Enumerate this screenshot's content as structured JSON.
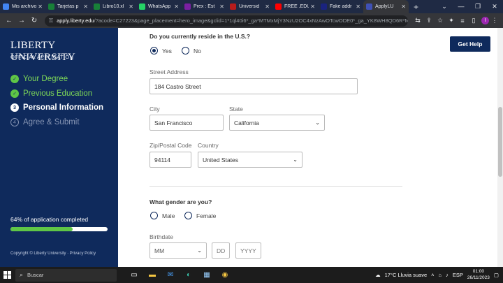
{
  "browser": {
    "tabs": [
      {
        "title": "Mis archivos",
        "color": "#4285f4",
        "active": false
      },
      {
        "title": "Tarjetas p",
        "color": "#188038",
        "active": false
      },
      {
        "title": "Libro10.xl",
        "color": "#188038",
        "active": false
      },
      {
        "title": "WhatsApp",
        "color": "#25d366",
        "active": false
      },
      {
        "title": "Prex : Est",
        "color": "#7b1fa2",
        "active": false
      },
      {
        "title": "Universid",
        "color": "#b71c1c",
        "active": false
      },
      {
        "title": "FREE .EDU",
        "color": "#ff0000",
        "active": false
      },
      {
        "title": "Fake addr",
        "color": "#1a237e",
        "active": false
      },
      {
        "title": "ApplyLU",
        "color": "#3f51b5",
        "active": true
      }
    ],
    "url_host": "apply.liberty.edu",
    "url_path": "/?acode=C27223&page_placement=hero_image&gclid=1*1ql40i6*_ga*MTMxMjY3NzU2OC4xNzAwOTcwODE0*_ga_YK8WH8QD6R*MTcw...",
    "profile_initial": "I"
  },
  "sidebar": {
    "brand": "LIBERTY UNIVERSITY",
    "brand_sub": "OFFICIAL APPLICATION",
    "steps": [
      {
        "mark": "✓",
        "label": "Your Degree",
        "state": "done"
      },
      {
        "mark": "✓",
        "label": "Previous Education",
        "state": "done"
      },
      {
        "mark": "3",
        "label": "Personal Information",
        "state": "current"
      },
      {
        "mark": "4",
        "label": "Agree & Submit",
        "state": "todo"
      }
    ],
    "progress_text": "64% of application completed",
    "progress_value": 0.64,
    "copyright": "Copyright © Liberty University · Privacy Policy"
  },
  "form": {
    "reside_question": "Do you currently reside in the U.S.?",
    "reside_yes": "Yes",
    "reside_no": "No",
    "street_label": "Street Address",
    "street_value": "184 Castro Street",
    "city_label": "City",
    "city_value": "San Francisco",
    "state_label": "State",
    "state_value": "California",
    "zip_label": "Zip/Postal Code",
    "zip_value": "94114",
    "country_label": "Country",
    "country_value": "United States",
    "gender_question": "What gender are you?",
    "gender_male": "Male",
    "gender_female": "Female",
    "birthdate_label": "Birthdate",
    "month_placeholder": "MM",
    "day_placeholder": "DD",
    "year_placeholder": "YYYY"
  },
  "help_button": "Get Help",
  "taskbar": {
    "search_placeholder": "Buscar",
    "weather": "17°C  Lluvia suave",
    "language": "ESP",
    "time": "01:00",
    "date": "26/11/2023"
  },
  "colors": {
    "sidebar_bg": "#0f2a5c",
    "accent_green": "#5fc646"
  }
}
